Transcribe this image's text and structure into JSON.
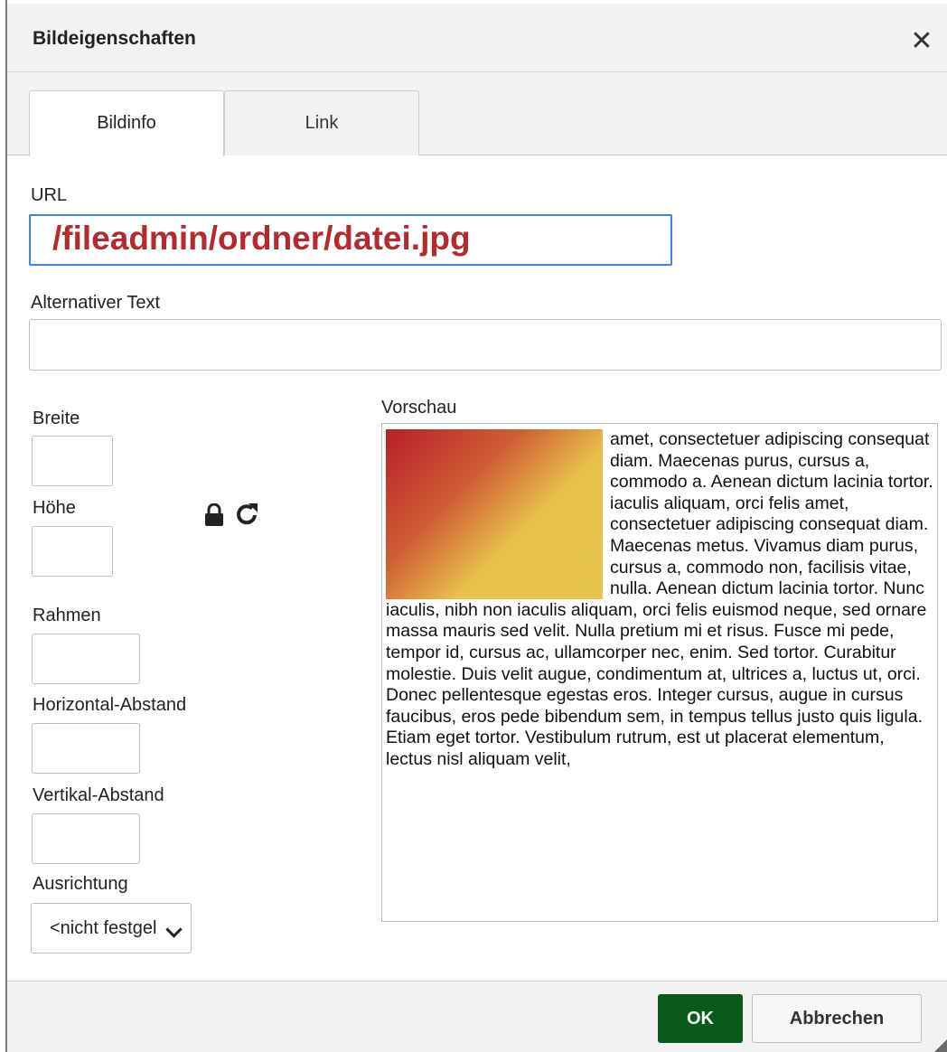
{
  "dialog": {
    "title": "Bildeigenschaften"
  },
  "tabs": [
    {
      "label": "Bildinfo",
      "active": true
    },
    {
      "label": "Link",
      "active": false
    }
  ],
  "form": {
    "url": {
      "label": "URL",
      "value": "/fileadmin/ordner/datei.jpg"
    },
    "alt_text": {
      "label": "Alternativer Text",
      "value": ""
    },
    "width": {
      "label": "Breite",
      "value": ""
    },
    "height": {
      "label": "Höhe",
      "value": ""
    },
    "border": {
      "label": "Rahmen",
      "value": ""
    },
    "hspace": {
      "label": "Horizontal-Abstand",
      "value": ""
    },
    "vspace": {
      "label": "Vertikal-Abstand",
      "value": ""
    },
    "align": {
      "label": "Ausrichtung",
      "selected": "<nicht festgelegt>"
    }
  },
  "icons": {
    "lock": "lock-icon",
    "reset": "refresh-icon"
  },
  "preview": {
    "label": "Vorschau",
    "text": "amet, consectetuer adipiscing consequat diam. Maecenas purus, cursus a, commodo a. Aenean dictum lacinia tortor. iaculis aliquam, orci felis amet, consectetuer adipiscing consequat diam. Maecenas metus. Vivamus diam purus, cursus a, commodo non, facilisis vitae, nulla. Aenean dictum lacinia tortor. Nunc iaculis, nibh non iaculis aliquam, orci felis euismod neque, sed ornare massa mauris sed velit. Nulla pretium mi et risus. Fusce mi pede, tempor id, cursus ac, ullamcorper nec, enim. Sed tortor. Curabitur molestie. Duis velit augue, condimentum at, ultrices a, luctus ut, orci. Donec pellentesque egestas eros. Integer cursus, augue in cursus faucibus, eros pede bibendum sem, in tempus tellus justo quis ligula. Etiam eget tortor. Vestibulum rutrum, est ut placerat elementum, lectus nisl aliquam velit,"
  },
  "buttons": {
    "ok": "OK",
    "cancel": "Abbrechen"
  },
  "colors": {
    "primary": "#0b5a1c",
    "url_text": "#b52a2f",
    "focus_border": "#3d86d8"
  }
}
